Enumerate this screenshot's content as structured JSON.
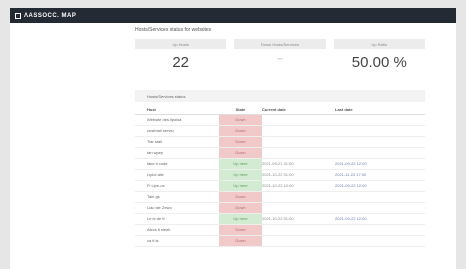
{
  "header": {
    "brand": "ɅASSOCC. MAP"
  },
  "page": {
    "title": "Hosts/Services status for websites"
  },
  "stats": [
    {
      "label": "Up Hosts",
      "value": "22",
      "small": false
    },
    {
      "label": "Down Hosts/Services",
      "value": "--",
      "small": true
    },
    {
      "label": "Up Ratio",
      "value": "50.00 %",
      "small": false
    }
  ],
  "section": {
    "title": "Hosts/Services status"
  },
  "table": {
    "headers": {
      "name": "Host",
      "state": "State",
      "current": "Current date",
      "last": "Last date"
    },
    "rows": [
      {
        "name": "Website des lipolsa",
        "state": "Down",
        "state_class": "down",
        "current": "",
        "last": ""
      },
      {
        "name": "cnstmail server",
        "state": "Down",
        "state_class": "down",
        "current": "",
        "last": ""
      },
      {
        "name": "Tiar stail",
        "state": "Down",
        "state_class": "down",
        "current": "",
        "last": ""
      },
      {
        "name": "tan wpey",
        "state": "Down",
        "state_class": "down",
        "current": "",
        "last": ""
      },
      {
        "name": "fake ti code",
        "state": "Up here",
        "state_class": "up",
        "current": "2021-09-21 01:00",
        "last": "2021-09-22 12:00"
      },
      {
        "name": "Lipiol alle",
        "state": "Up here",
        "state_class": "up",
        "current": "2021-10-22 01:00",
        "last": "2021-11-22 17:00"
      },
      {
        "name": "Fi Lipe-os",
        "state": "Up here",
        "state_class": "up",
        "current": "2021-10-22 10:00",
        "last": "2021-09-22 12:00"
      },
      {
        "name": "Tain gs",
        "state": "Down",
        "state_class": "down",
        "current": "",
        "last": ""
      },
      {
        "name": "Liac ste Zewo",
        "state": "Down",
        "state_class": "down",
        "current": "",
        "last": ""
      },
      {
        "name": "Le le de tt",
        "state": "Up here",
        "state_class": "up",
        "current": "2021-10-22 01:00",
        "last": "2021-09-22 12:00"
      },
      {
        "name": "Alecs fi sleek",
        "state": "Down",
        "state_class": "down",
        "current": "",
        "last": ""
      },
      {
        "name": "ca ti ts",
        "state": "Down",
        "state_class": "down",
        "current": "",
        "last": ""
      }
    ]
  }
}
